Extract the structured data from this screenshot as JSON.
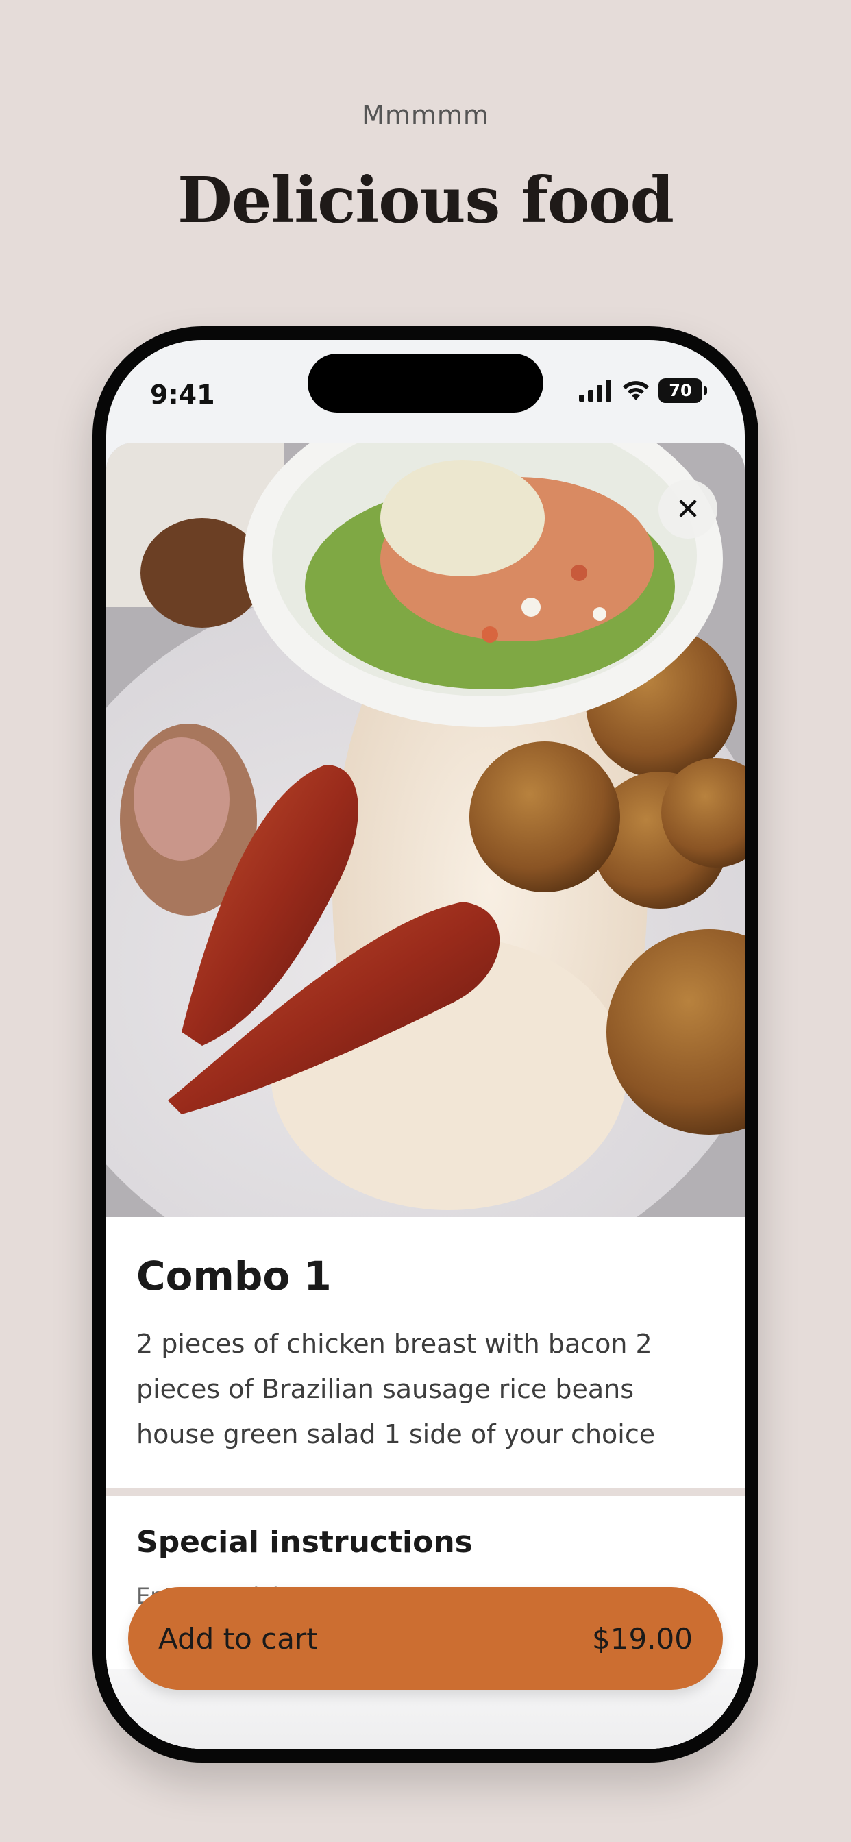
{
  "header": {
    "eyebrow": "Mmmmm",
    "headline": "Delicious food"
  },
  "status_bar": {
    "time": "9:41",
    "battery_level": "70",
    "icons": [
      "signal-icon",
      "wifi-icon",
      "battery-icon"
    ]
  },
  "item": {
    "image_description": "Plate with grilled chicken wrapped in bacon, two Brazilian sausages, white rice, fried balls and a bowl of salad with pico de gallo and sauce",
    "title": "Combo 1",
    "description": "2 pieces of chicken breast with bacon 2 pieces of Brazilian sausage rice beans house green salad 1 side of your choice"
  },
  "special_instructions": {
    "title": "Special instructions",
    "placeholder": "Enter special requests"
  },
  "cart": {
    "label": "Add to cart",
    "price": "$19.00"
  },
  "colors": {
    "background": "#e5dcd9",
    "accent": "#cc6e31",
    "phone_frame": "#070707"
  }
}
